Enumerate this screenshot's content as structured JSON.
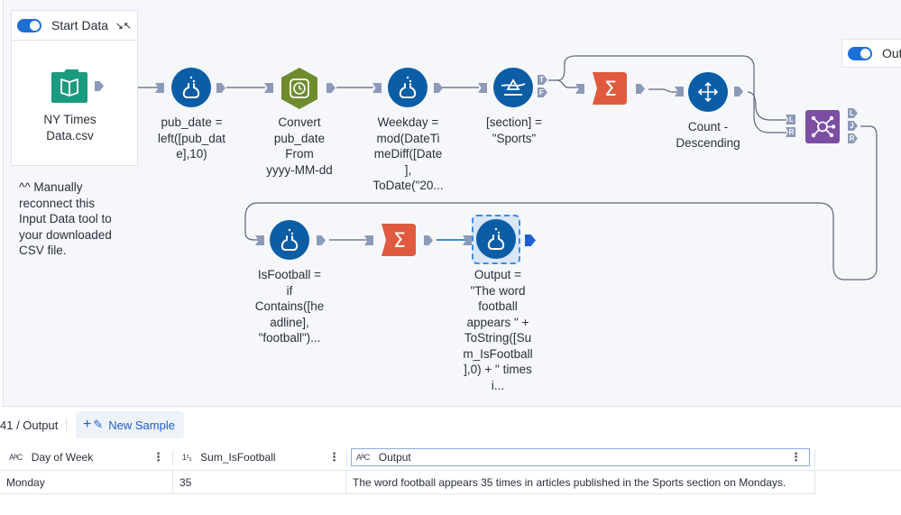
{
  "canvas": {
    "start_container": {
      "title": "Start Data",
      "enabled": true,
      "collapse_icon": "collapse-arrows-icon",
      "input_tool": {
        "icon": "book-icon",
        "label": "NY Times\nData.csv",
        "color": "#1a9b7f"
      }
    },
    "note": "^^ Manually\nreconnect this\nInput Data tool to\nyour downloaded\nCSV file.",
    "output_container": {
      "title": "Out",
      "enabled": true
    },
    "tools": [
      {
        "id": "formula-pub-date",
        "type": "formula",
        "icon": "flask-icon",
        "label": "pub_date =\nleft([pub_dat\ne],10)",
        "color": "#0b5da6"
      },
      {
        "id": "datetime-convert",
        "type": "datetime",
        "icon": "clock-icon",
        "label": "Convert\npub_date\nFrom\nyyyy-MM-dd",
        "color": "#6e8b2e"
      },
      {
        "id": "formula-weekday",
        "type": "formula",
        "icon": "flask-icon",
        "label": "Weekday =\nmod(DateTi\nmeDiff([Date\n],\nToDate(\"20...",
        "color": "#0b5da6"
      },
      {
        "id": "filter-section",
        "type": "filter",
        "icon": "filter-icon",
        "label": "[section] =\n\"Sports\"",
        "color": "#0b5da6",
        "anchors": [
          "T",
          "F"
        ]
      },
      {
        "id": "summarize-1",
        "type": "summarize",
        "icon": "sigma-icon",
        "label": "",
        "color": "#e05a3f"
      },
      {
        "id": "sort-count",
        "type": "sort",
        "icon": "move-arrows-icon",
        "label": "Count -\nDescending",
        "color": "#0b5da6"
      },
      {
        "id": "join",
        "type": "join",
        "icon": "join-nodes-icon",
        "label": "",
        "color": "#7b4ea3",
        "in_anchors": [
          "L",
          "R"
        ],
        "out_anchors": [
          "L",
          "J",
          "R"
        ]
      },
      {
        "id": "formula-isfootball",
        "type": "formula",
        "icon": "flask-icon",
        "label": "IsFootball =\nif\nContains([he\nadline],\n\"football\")...",
        "color": "#0b5da6"
      },
      {
        "id": "summarize-2",
        "type": "summarize",
        "icon": "sigma-icon",
        "label": "",
        "color": "#e05a3f"
      },
      {
        "id": "formula-output",
        "type": "formula",
        "icon": "flask-icon",
        "label": "Output =\n\"The word\nfootball\nappears \" +\nToString([Su\nm_IsFootball\n],0) + \" times\ni...",
        "color": "#0b5da6",
        "selected": true
      }
    ]
  },
  "results": {
    "breadcrumb": "41 / Output",
    "new_sample_label": "New Sample",
    "new_sample_icons": [
      "plus-icon",
      "eyedropper-icon"
    ],
    "columns": [
      {
        "type_icon": "AᴮC",
        "type": "string",
        "name": "Day of Week"
      },
      {
        "type_icon": "1²₃",
        "type": "number",
        "name": "Sum_IsFootball"
      },
      {
        "type_icon": "AᴮC",
        "type": "string",
        "name": "Output",
        "active": true
      }
    ],
    "rows": [
      [
        "Monday",
        "35",
        "The word football appears 35 times in articles published in the Sports section on Mondays."
      ]
    ]
  }
}
